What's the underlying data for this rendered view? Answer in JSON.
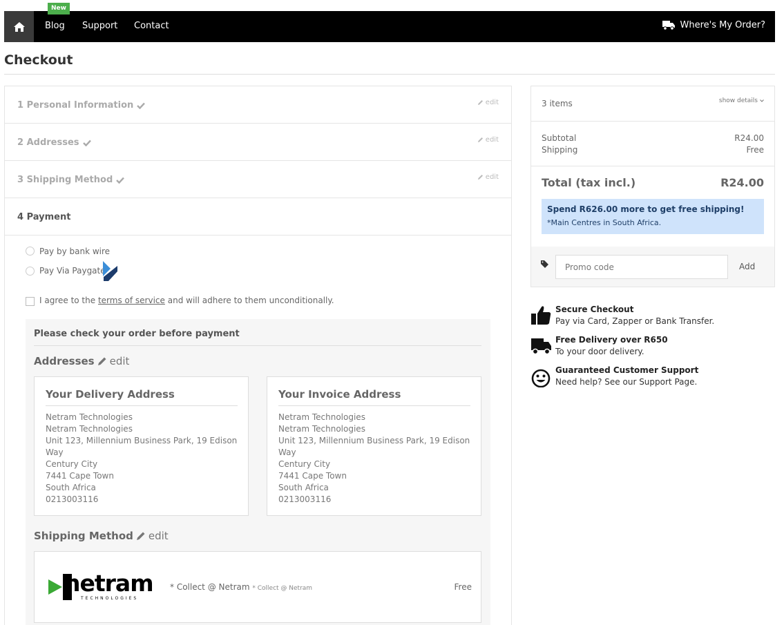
{
  "nav": {
    "blog": "Blog",
    "blog_badge": "New",
    "support": "Support",
    "contact": "Contact",
    "wheres_my_order": "Where's My Order?"
  },
  "page_title": "Checkout",
  "steps": [
    {
      "label": "1 Personal Information",
      "edit": "edit",
      "done": true
    },
    {
      "label": "2 Addresses",
      "edit": "edit",
      "done": true
    },
    {
      "label": "3 Shipping Method",
      "edit": "edit",
      "done": true
    },
    {
      "label": "4 Payment",
      "edit": "",
      "done": false
    }
  ],
  "payment": {
    "option_bank_wire": "Pay by bank wire",
    "option_paygate": "Pay Via Paygate",
    "terms_prefix": "I agree to the",
    "terms_link": "terms of service",
    "terms_suffix": "and will adhere to them unconditionally."
  },
  "review": {
    "heading": "Please check your order before payment",
    "addresses_title": "Addresses",
    "edit_label": "edit",
    "delivery": {
      "title": "Your Delivery Address",
      "lines": [
        "Netram Technologies",
        "Netram Technologies",
        "Unit 123, Millennium Business Park, 19 Edison Way",
        "Century City",
        "7441 Cape Town",
        "South Africa",
        "0213003116"
      ]
    },
    "invoice": {
      "title": "Your Invoice Address",
      "lines": [
        "Netram Technologies",
        "Netram Technologies",
        "Unit 123, Millennium Business Park, 19 Edison Way",
        "Century City",
        "7441 Cape Town",
        "South Africa",
        "0213003116"
      ]
    },
    "shipping_title": "Shipping Method",
    "carrier_logo_text": "netram",
    "carrier_logo_sub": "TECHNOLOGIES",
    "carrier_name": "* Collect @ Netram",
    "carrier_delay": "* Collect @ Netram",
    "carrier_price": "Free"
  },
  "summary": {
    "items_count": "3 items",
    "show_details": "show details",
    "subtotal_label": "Subtotal",
    "subtotal_value": "R24.00",
    "shipping_label": "Shipping",
    "shipping_value": "Free",
    "total_label": "Total (tax incl.)",
    "total_value": "R24.00",
    "free_ship_msg": "Spend R626.00 more to get free shipping!",
    "free_ship_note": "*Main Centres in South Africa.",
    "promo_placeholder": "Promo code",
    "promo_add": "Add"
  },
  "reassurance": [
    {
      "icon": "thumbs-up-icon",
      "title": "Secure Checkout",
      "sub": "Pay via Card, Zapper or Bank Transfer."
    },
    {
      "icon": "truck-icon",
      "title": "Free Delivery over R650",
      "sub": "To your door delivery."
    },
    {
      "icon": "smiley-icon",
      "title": "Guaranteed Customer Support",
      "sub": "Need help? See our Support Page."
    }
  ]
}
